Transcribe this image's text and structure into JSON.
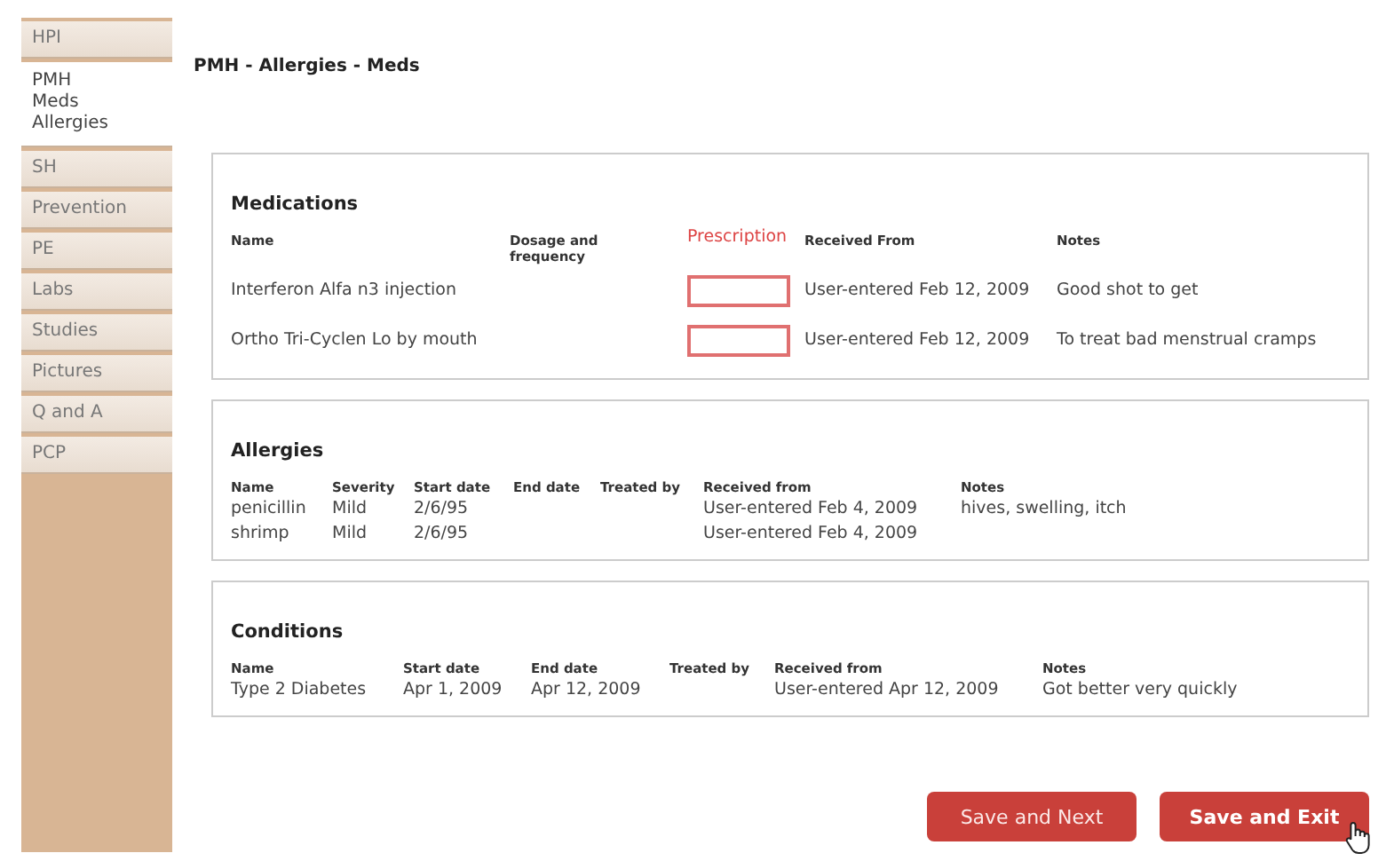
{
  "sidebar": {
    "items": [
      {
        "label": "HPI",
        "selected": false
      },
      {
        "label": "PMH\nMeds\nAllergies",
        "selected": true
      },
      {
        "label": "SH",
        "selected": false
      },
      {
        "label": "Prevention",
        "selected": false
      },
      {
        "label": "PE",
        "selected": false
      },
      {
        "label": "Labs",
        "selected": false
      },
      {
        "label": "Studies",
        "selected": false
      },
      {
        "label": "Pictures",
        "selected": false
      },
      {
        "label": "Q and A",
        "selected": false
      },
      {
        "label": "PCP",
        "selected": false
      }
    ]
  },
  "page_title": "PMH - Allergies - Meds",
  "sections": [
    {
      "title": "Medications",
      "columns": [
        {
          "label": "Name",
          "kind": "name"
        },
        {
          "label": "Dosage and frequency",
          "kind": "dosage"
        },
        {
          "label": "Prescription",
          "kind": "prescription"
        },
        {
          "label": "Received From",
          "kind": "received_from"
        },
        {
          "label": "Notes",
          "kind": "notes"
        }
      ],
      "rows": [
        {
          "name": "Interferon Alfa n3 injection",
          "received_from": "User-entered Feb 12, 2009",
          "notes": "Good shot to get"
        },
        {
          "name": "Ortho Tri-Cyclen Lo by mouth",
          "received_from": "User-entered Feb 12, 2009",
          "notes": "To treat bad menstrual cramps"
        }
      ]
    },
    {
      "title": "Allergies",
      "columns": [
        {
          "label": "Name",
          "kind": "name"
        },
        {
          "label": "Severity",
          "kind": "severity"
        },
        {
          "label": "Start date",
          "kind": "start_date"
        },
        {
          "label": "End date",
          "kind": "end_date"
        },
        {
          "label": "Treated by",
          "kind": "treated_by"
        },
        {
          "label": "Received from",
          "kind": "received_from"
        },
        {
          "label": "Notes",
          "kind": "notes"
        }
      ],
      "rows": [
        {
          "name": "penicillin",
          "severity": "Mild",
          "start_date": "2/6/95",
          "received_from": "User-entered Feb 4, 2009",
          "notes": "hives, swelling, itch"
        },
        {
          "name": "shrimp",
          "severity": "Mild",
          "start_date": "2/6/95",
          "received_from": "User-entered Feb 4, 2009"
        }
      ]
    },
    {
      "title": "Conditions",
      "columns": [
        {
          "label": "Name",
          "kind": "name"
        },
        {
          "label": "Start date",
          "kind": "start_date"
        },
        {
          "label": "End date",
          "kind": "end_date"
        },
        {
          "label": "Treated by",
          "kind": "treated_by"
        },
        {
          "label": "Received from",
          "kind": "received_from"
        },
        {
          "label": "Notes",
          "kind": "notes"
        }
      ],
      "rows": [
        {
          "name": "Type 2 Diabetes",
          "start_date": "Apr 1, 2009",
          "end_date": "Apr 12, 2009",
          "received_from": "User-entered Apr 12, 2009",
          "notes": "Got better very quickly"
        }
      ]
    }
  ],
  "buttons": [
    {
      "label": "Save and Next",
      "kind": "secondary"
    },
    {
      "label": "Save and Exit",
      "kind": "primary"
    }
  ]
}
